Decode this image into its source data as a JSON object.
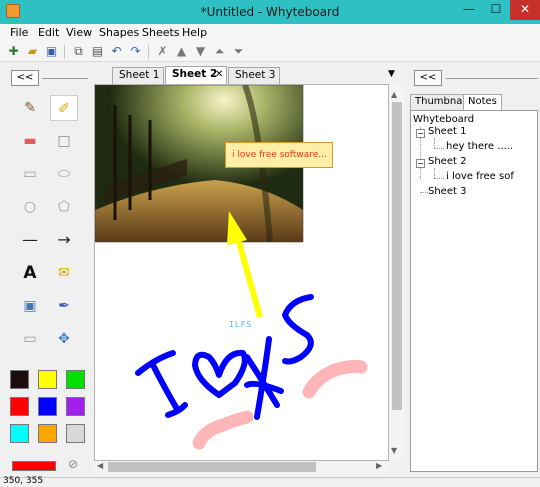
{
  "window": {
    "title": "*Untitled - Whyteboard",
    "min": "—",
    "max": "☐",
    "close": "✕"
  },
  "menu": [
    "File",
    "Edit",
    "View",
    "Shapes",
    "Sheets",
    "Help"
  ],
  "toolbar": {
    "icons": [
      "new-icon",
      "open-icon",
      "save-icon",
      "copy-icon",
      "paste-icon",
      "undo-icon",
      "redo-icon",
      "delete-icon",
      "move-up-icon",
      "move-down-icon",
      "move-top-icon",
      "move-bottom-icon"
    ]
  },
  "left_panel": {
    "collapse_label": "<<",
    "tools": [
      {
        "name": "pen-tool",
        "glyph": "✎"
      },
      {
        "name": "highlighter-tool",
        "glyph": "✐"
      },
      {
        "name": "eraser-tool",
        "glyph": "▬"
      },
      {
        "name": "rectangle-tool",
        "glyph": "□"
      },
      {
        "name": "rounded-rect-tool",
        "glyph": "▭"
      },
      {
        "name": "ellipse-tool",
        "glyph": "⬭"
      },
      {
        "name": "circle-tool",
        "glyph": "○"
      },
      {
        "name": "polygon-tool",
        "glyph": "⬠"
      },
      {
        "name": "line-tool",
        "glyph": "—"
      },
      {
        "name": "arrow-tool",
        "glyph": "→"
      },
      {
        "name": "text-tool",
        "glyph": "A"
      },
      {
        "name": "note-tool",
        "glyph": "✉"
      },
      {
        "name": "media-tool",
        "glyph": "▣"
      },
      {
        "name": "eyedropper-tool",
        "glyph": "✒"
      },
      {
        "name": "image-tool",
        "glyph": "▭"
      },
      {
        "name": "select-tool",
        "glyph": "✥"
      }
    ],
    "colors": [
      "#1a0d0d",
      "#ffff00",
      "#00e000",
      "#ff0000",
      "#0000ff",
      "#a020f0",
      "#00ffff",
      "#ffa500",
      "#d8d8d8"
    ],
    "current_color": "#ff0000"
  },
  "tabs": [
    {
      "label": "Sheet 1",
      "active": false
    },
    {
      "label": "Sheet 2",
      "active": true
    },
    {
      "label": "Sheet 3",
      "active": false
    }
  ],
  "tab_close": "✕",
  "tab_menu": "▼",
  "canvas": {
    "note_text": "i love free software...",
    "small_text": "ILFS",
    "colors": {
      "arrow": "#ffff00",
      "ink": "#0000ff",
      "pink": "#ffb6b9"
    }
  },
  "right_panel": {
    "collapse_label": "<<",
    "tabs": [
      "Thumbnails",
      "Notes"
    ],
    "active_tab": "Notes",
    "tree": {
      "root": "Whyteboard",
      "sheets": [
        {
          "label": "Sheet 1",
          "notes": [
            "hey there ....."
          ]
        },
        {
          "label": "Sheet 2",
          "notes": [
            "i love free sof"
          ]
        },
        {
          "label": "Sheet 3",
          "notes": []
        }
      ]
    }
  },
  "status": {
    "coords": "350, 355"
  }
}
